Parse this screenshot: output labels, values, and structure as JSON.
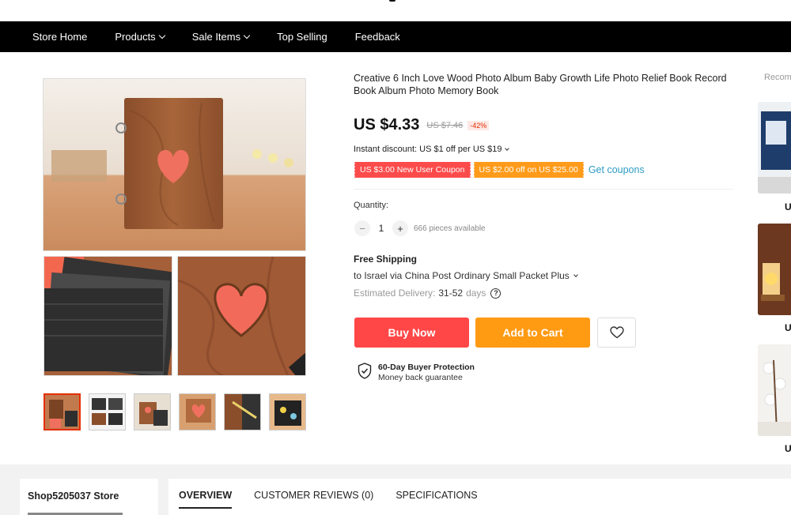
{
  "nav": {
    "items": [
      {
        "label": "Store Home",
        "dropdown": false
      },
      {
        "label": "Products",
        "dropdown": true
      },
      {
        "label": "Sale Items",
        "dropdown": true
      },
      {
        "label": "Top Selling",
        "dropdown": false
      },
      {
        "label": "Feedback",
        "dropdown": false
      }
    ]
  },
  "product": {
    "title": "Creative 6 Inch Love Wood Photo Album Baby Growth Life Photo Relief Book Record Book Album Photo Memory Book",
    "price": "US $4.33",
    "old_price": "US $7.46",
    "discount": "-42%",
    "instant_discount": "Instant discount: US $1 off per US $19",
    "coupons": [
      "US $3.00 New User Coupon",
      "US $2.00 off on US $25.00"
    ],
    "get_coupons": "Get coupons",
    "quantity_label": "Quantity:",
    "quantity_value": "1",
    "quantity_minus": "−",
    "quantity_plus": "+",
    "available": "666 pieces available",
    "shipping_title": "Free Shipping",
    "shipping_route": "to Israel via China Post Ordinary Small Packet Plus",
    "delivery_label": "Estimated Delivery:",
    "delivery_value": "31-52",
    "delivery_unit": "days",
    "buy_now": "Buy Now",
    "add_to_cart": "Add to Cart",
    "protection_title": "60-Day Buyer Protection",
    "protection_sub": "Money back guarantee"
  },
  "recommend": {
    "label": "Recommended",
    "price_prefix": "U"
  },
  "store": {
    "name": "Shop5205037 Store"
  },
  "tabs": [
    "OVERVIEW",
    "CUSTOMER REVIEWS (0)",
    "SPECIFICATIONS"
  ],
  "colors": {
    "buy": "#ff4747",
    "cart": "#ff9a13",
    "link": "#2e9cc3",
    "accent": "#e62e04"
  }
}
